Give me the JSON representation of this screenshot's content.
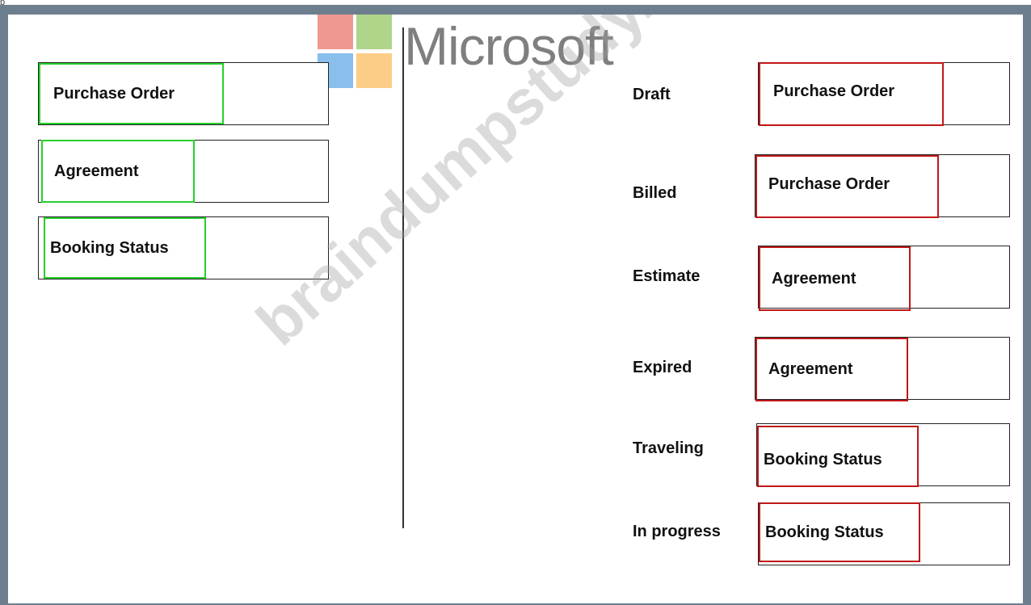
{
  "top_mark": "p",
  "logo": {
    "text": "Microsoft"
  },
  "watermark": "braindumpstudy.com",
  "source_tiles": [
    {
      "label": "Purchase Order"
    },
    {
      "label": "Agreement"
    },
    {
      "label": "Booking Status"
    }
  ],
  "targets": [
    {
      "status": "Draft",
      "answer": "Purchase Order"
    },
    {
      "status": "Billed",
      "answer": "Purchase Order"
    },
    {
      "status": "Estimate",
      "answer": "Agreement"
    },
    {
      "status": "Expired",
      "answer": "Agreement"
    },
    {
      "status": "Traveling",
      "answer": "Booking Status"
    },
    {
      "status": "In progress",
      "answer": "Booking Status"
    }
  ],
  "colors": {
    "frame": "#6d7f8f",
    "source_highlight": "#25d02c",
    "answer_highlight": "#c01818"
  }
}
